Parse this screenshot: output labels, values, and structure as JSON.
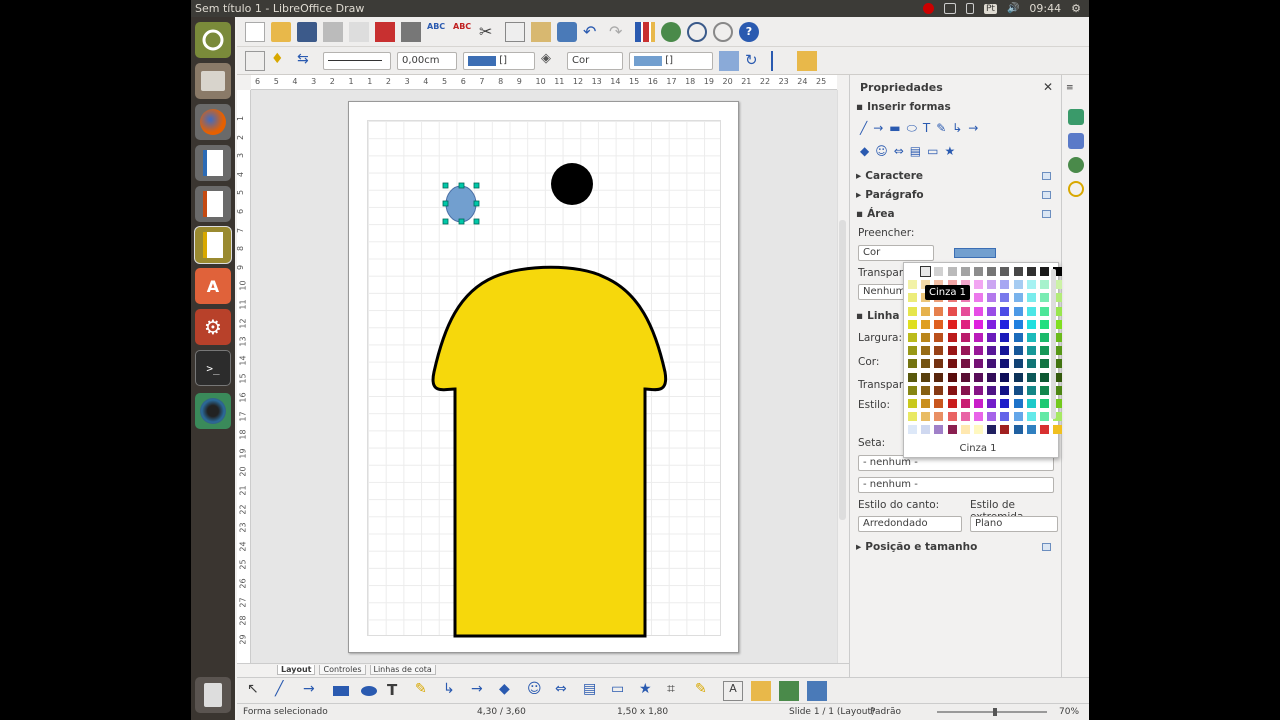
{
  "window": {
    "title": "Sem título 1 - LibreOffice Draw",
    "time": "09:44",
    "keyboard": "Pt"
  },
  "toolbar2": {
    "line_width": "0,00cm",
    "area_fill": "Cor",
    "color_box": "[]",
    "color_box2": "[]"
  },
  "ruler": {
    "h_ticks": [
      "6",
      "5",
      "4",
      "3",
      "2",
      "1",
      "1",
      "2",
      "3",
      "4",
      "5",
      "6",
      "7",
      "8",
      "9",
      "10",
      "11",
      "12",
      "13",
      "14",
      "15",
      "16",
      "17",
      "18",
      "19",
      "20",
      "21",
      "22",
      "23",
      "24",
      "25"
    ],
    "v_ticks": [
      "1",
      "2",
      "3",
      "4",
      "5",
      "6",
      "7",
      "8",
      "9",
      "10",
      "11",
      "12",
      "13",
      "14",
      "15",
      "16",
      "17",
      "18",
      "19",
      "20",
      "21",
      "22",
      "23",
      "24",
      "25",
      "26",
      "27",
      "28",
      "29"
    ]
  },
  "tabs": [
    "Layout",
    "Controles",
    "Linhas de cota"
  ],
  "sidebar": {
    "title": "Propriedades",
    "close": "✕",
    "sections": {
      "insert_shapes": "Inserir formas",
      "character": "Caractere",
      "paragraph": "Parágrafo",
      "area": "Área",
      "line": "Linha",
      "position": "Posição e tamanho"
    },
    "fill_label": "Preencher:",
    "fill_value": "Cor",
    "transparency_label": "Transparê",
    "transparency_value": "Nenhum",
    "width_label": "Largura:",
    "color_label": "Cor:",
    "line_transparency_label": "Transparê",
    "style_label": "Estilo:",
    "arrow_label": "Seta:",
    "arrow_start": "- nenhum -",
    "arrow_end": "- nenhum -",
    "corner_label": "Estilo do canto:",
    "corner_value": "Arredondado",
    "cap_label": "Estilo de extremida",
    "cap_value": "Plano"
  },
  "palette": {
    "selected_name": "Cinza 1",
    "tooltip": "Cinza 1"
  },
  "status": {
    "selection": "Forma selecionado",
    "position": "4,30 / 3,60",
    "size": "1,50 x 1,80",
    "slide": "Slide 1 / 1 (Layout)",
    "style": "Padrão",
    "zoom": "70%"
  },
  "colors": {
    "yellow_shape": "#f6d80c",
    "blue_shape": "#729fcf",
    "selection_handle": "#00c8a8"
  }
}
